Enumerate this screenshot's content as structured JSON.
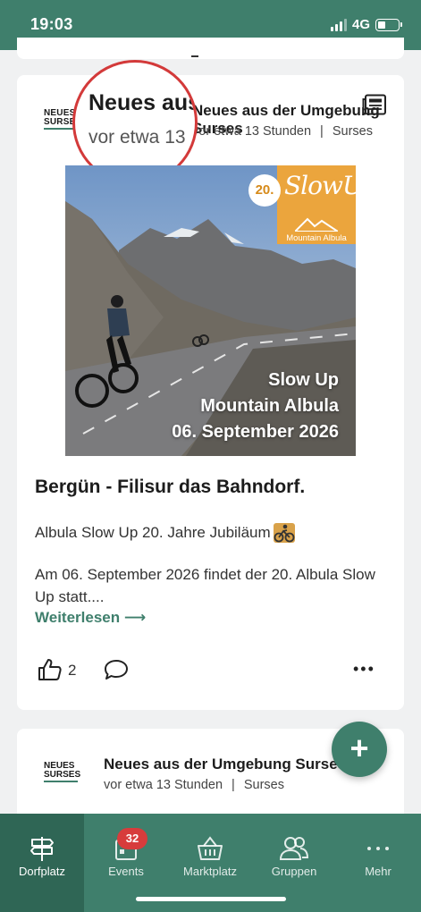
{
  "status_bar": {
    "time": "19:03",
    "network": "4G"
  },
  "post": {
    "logo_line1": "NEUES",
    "logo_line2": "SURSES",
    "title": "Neues aus der Umgebung Surses",
    "time": "vor etwa 13 Stunden",
    "separator": "|",
    "location": "Surses",
    "magnifier": {
      "title": "Neues aus",
      "meta": "vor etwa 13"
    },
    "image": {
      "badge_number": "20.",
      "badge_logo": "SlowUp",
      "badge_subtitle": "Mountain Albula",
      "line1": "Slow Up",
      "line2": "Mountain Albula",
      "line3": "06. September 2026"
    },
    "heading": "Bergün - Filisur das Bahndorf.",
    "teaser": "Albula Slow Up 20. Jahre Jubiläum",
    "body": "Am 06. September 2026 findet der 20. Albula Slow Up statt....",
    "read_more": "Weiterlesen ⟶",
    "like_count": "2",
    "more": "•••"
  },
  "post2": {
    "logo_line1": "NEUES",
    "logo_line2": "SURSES",
    "title": "Neues aus der Umgebung Surses",
    "time": "vor etwa 13 Stunden",
    "separator": "|",
    "location": "Surses"
  },
  "fab": {
    "label": "+"
  },
  "tabs": [
    {
      "label": "Dorfplatz",
      "icon": "signpost-icon",
      "active": true
    },
    {
      "label": "Events",
      "icon": "calendar-icon",
      "badge": "32"
    },
    {
      "label": "Marktplatz",
      "icon": "basket-icon"
    },
    {
      "label": "Gruppen",
      "icon": "group-icon"
    },
    {
      "label": "Mehr",
      "icon": "more-dots-icon"
    }
  ],
  "colors": {
    "primary": "#3f7f6c",
    "badge": "#d73c3c",
    "accent_orange": "#eba53d"
  }
}
